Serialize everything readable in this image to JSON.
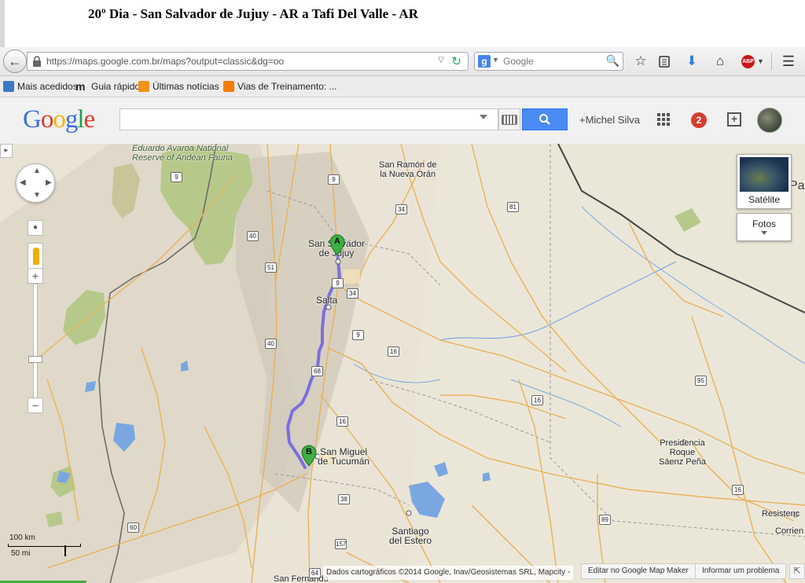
{
  "page_title": "20º Dia - San Salvador de Jujuy - AR a Tafi Del Valle - AR",
  "browser": {
    "url": "https://maps.google.com.br/maps?output=classic&dg=oo",
    "search_placeholder": "Google",
    "bookmarks": [
      {
        "label": "Mais acedidos",
        "icon": "folder-icon",
        "color": "#3b78c2"
      },
      {
        "label": "Guia rápido",
        "icon": "m-icon",
        "color": "#222222"
      },
      {
        "label": "Últimas notícias",
        "icon": "rss-icon",
        "color": "#f29216"
      },
      {
        "label": "Vias de Treinamento: ...",
        "icon": "blogger-icon",
        "color": "#f57d00"
      }
    ]
  },
  "maps_header": {
    "logo_text": "Google",
    "search_value": "",
    "user_link": "+Michel Silva",
    "notification_count": "2"
  },
  "map": {
    "place_labels": {
      "eduardo_avaroa": "Eduardo Avaroa National\nReserve of Andean Fauna",
      "san_ramon": "San Ramón de\nla Nueva Orán",
      "san_salvador": "San Salvador\nde Jujuy",
      "salta": "Salta",
      "san_miguel": "San Miguel\nde Tucumán",
      "presidencia": "Presidencia\nRoque\nSáenz Peña",
      "santiago": "Santiago\ndel Estero",
      "resistencia": "Resistenc",
      "corrientes": "Corrien",
      "san_fernando": "San Fernando",
      "pa": "Pa"
    },
    "route_shields": [
      "9",
      "34",
      "81",
      "40",
      "51",
      "9",
      "34",
      "16",
      "40",
      "68",
      "9",
      "16",
      "95",
      "16",
      "16",
      "38",
      "89",
      "157",
      "9",
      "60",
      "64"
    ],
    "markers": {
      "origin": "A",
      "destination": "B"
    },
    "satellite_label": "Satélite",
    "photos_label": "Fotos",
    "scale_km": "100 km",
    "scale_mi": "50 mi",
    "attribution": "Dados cartográficos ©2014 Google, Inav/Geosistemas SRL, Mapcity -",
    "edit_link": "Editar no Google Map Maker",
    "report_link": "Informar um problema"
  },
  "colors": {
    "route": "#7b6fe0",
    "park": "#b7c98a",
    "water": "#7aa7e0",
    "search_button": "#4a8af4"
  }
}
